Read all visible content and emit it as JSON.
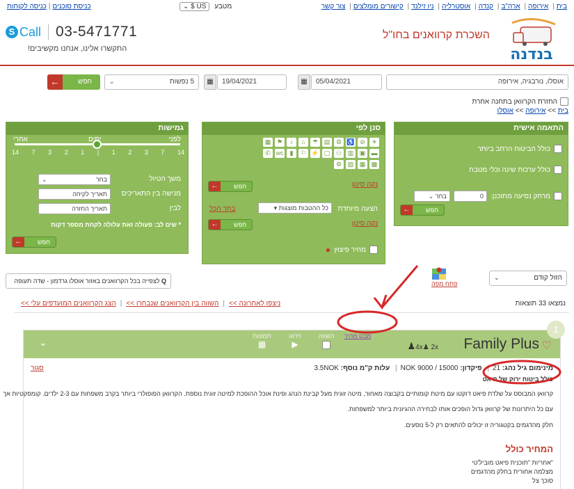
{
  "topnav": {
    "items": [
      "בית",
      "אירופה",
      "ארה\"ב",
      "קנדה",
      "אוסטרליה",
      "ניו זילנד",
      "קישורים מומלצים",
      "צור קשר"
    ],
    "currency_label": "מטבע",
    "currency_value": "US $"
  },
  "agents": {
    "agents_login": "כניסת סוכנים",
    "customers_login": "כניסה לקוחות"
  },
  "header": {
    "logo_text": "בנדנה",
    "tagline": "השכרת קרוואנים בחו\"ל",
    "call_text": "Call",
    "phone": "03-5471771",
    "callus": "התקשרו אלינו, אנחנו מקשיבים!"
  },
  "search": {
    "destination": "אוסלו, נורבגיה, אירופה",
    "date_from": "05/04/2021",
    "date_to": "19/04/2021",
    "passengers": "5 נפשות",
    "go_label": "חפש"
  },
  "options": {
    "return_other": "החזרת הקרוואן בתחנה אחרת",
    "breadcrumb": [
      "בית",
      "אירופה",
      "אוסלו"
    ]
  },
  "personal": {
    "title": "התאמה אישית",
    "opt1": "כולל הביטוח הרחב ביותר",
    "opt2": "כולל ערכות שינה וכלי מטבח",
    "opt3_label": "מרחק נסיעה מתוכנן:",
    "opt3_value": "0",
    "opt3_select": "בחר",
    "go_label": "חפש"
  },
  "filter": {
    "title": "סנן לפי",
    "clear1": "נקה סינון",
    "go_label": "חפש",
    "special_label": "הצעה מיוחדת",
    "special_value": "כל ההטבות מוצגות",
    "select_all": "בחר הכל",
    "clear2": "נקה סינון",
    "price_cut": "מחיר פיצוץ"
  },
  "flex": {
    "title": "גמישות",
    "before": "לפני",
    "days": "ימים",
    "after": "אחרי",
    "ticks": [
      "14",
      "7",
      "3",
      "2",
      "1",
      "|",
      "1",
      "2",
      "3",
      "7",
      "14"
    ],
    "duration_label": "משך הטיול",
    "duration_value": "בחר",
    "pickup_label": "מנישה בין התאריכים",
    "pickup_placeholder": "תאריך לקיחה",
    "to_label": "לבין",
    "return_placeholder": "תאריך החזרה",
    "note": "* שים לב: פעולה זאת עלולה לקחת מספר דקות",
    "go_label": "חפש"
  },
  "listing": {
    "map_search": "לצפייה בכל הקרוואנים באזור אוסלו גרדמון - שדה תעופה",
    "sort_value": "הזול קודם",
    "open_map": "פתח מפה",
    "count": "נמצאו 33 תוצאות",
    "action1": "הצג הקרוואנים המועדפים עלי >>",
    "action2": "השווה בין הקרוואנים שנבחרו >>",
    "action3": "ניצפו לאחרונה >>"
  },
  "card": {
    "index": "1",
    "title": "Family Plus",
    "cap_adults": "2x",
    "cap_kids": "4x",
    "tab_price": "מבט מהיר",
    "tab_compare": "השווה",
    "tab_video": "וידאו",
    "tab_photos": "תמונות",
    "min_age_label": "מינימום גיל נהג:",
    "min_age_value": "21",
    "deposit_label": "פיקדון:",
    "deposit_value": "NOK  9000 / 15000",
    "km_label": "עלות ק\"מ נוסף:",
    "km_value": "3.5NOK",
    "close": "סגור",
    "includes": "כולל ביטוח ירוק של פיאט",
    "desc1": "קרוואן המבוסס על שלדת פיאט דוקטו עם מיטת קומותיים בקבוצה מאחור, מיטה זוגית מעל קבינת הנהג ופינת אוכל ההופכת למיטה זוגית נוספת. הקרוואן הפופולרי ביותר בקרב משפחות עם 2-3 ילדים. קומפקטיות אך",
    "desc2": "עם כל היתרונות של קרוואן גדול הופכים אותו לבחירה ההגיונית ביותר למשפחות.",
    "desc3": "חלק מהדגמים בקטגוריה זו יכולים להתאים רק ל-5 נוסעים.",
    "price_title": "המחיר כולל",
    "price_line1": "\"אחריות \"תוכנית פיאט מוביל'טי",
    "price_line2": "מצלמה אחורית בחלק מהדגמים",
    "price_line3": "סוכך צל"
  },
  "colors": {
    "accent_red": "#c0392b",
    "panel_green": "#8fbb5a",
    "card_header_green": "#a9ca7c",
    "link_blue": "#0645ad"
  }
}
